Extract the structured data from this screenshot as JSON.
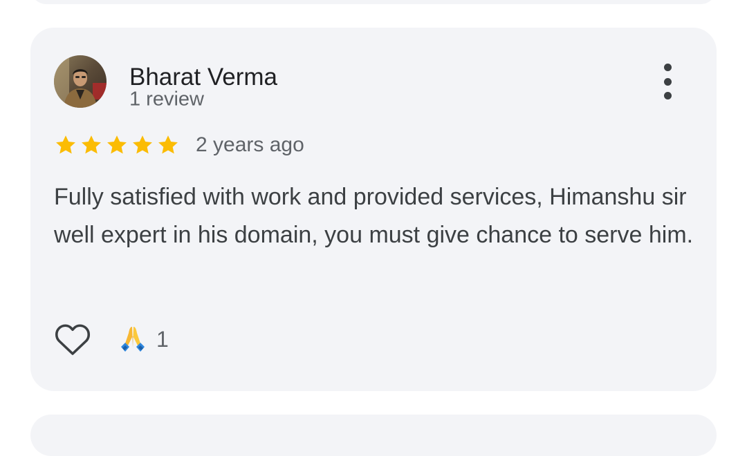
{
  "review": {
    "author": {
      "name": "Bharat Verma",
      "meta": "1 review",
      "avatar_icon": "user-photo"
    },
    "rating": {
      "stars": 5,
      "max_stars": 5,
      "star_color": "#fbbc04"
    },
    "date": "2 years ago",
    "text": "Fully satisfied with work and provided services, Himanshu sir well expert in his domain, you must give chance to serve him.",
    "actions": {
      "like_icon": "heart-outline-icon",
      "reaction_icon": "folded-hands-icon",
      "reaction_count": "1"
    },
    "more_icon": "more-vert-icon"
  },
  "colors": {
    "card_background": "#f3f4f7",
    "primary_text": "#202124",
    "secondary_text": "#5f6368"
  }
}
